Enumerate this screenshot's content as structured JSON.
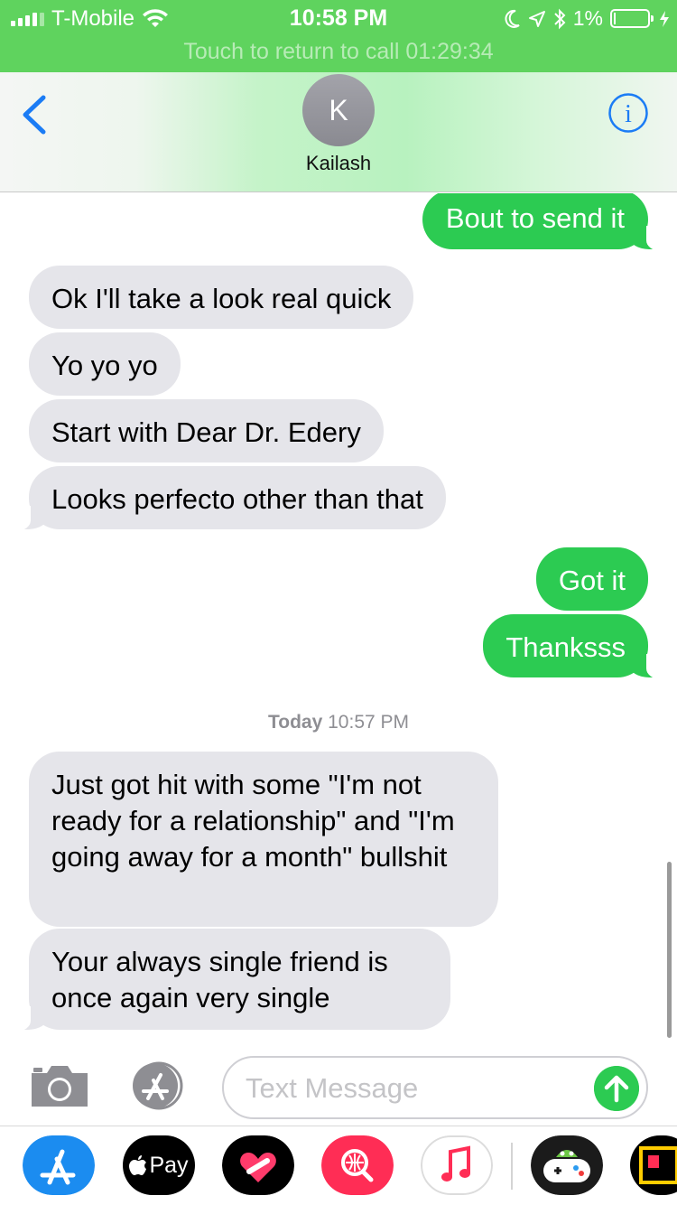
{
  "status_bar": {
    "carrier": "T-Mobile",
    "time": "10:58 PM",
    "battery": "1%",
    "call_banner": "Touch to return to call 01:29:34"
  },
  "header": {
    "avatar_initial": "K",
    "contact_name": "Kailash"
  },
  "messages": [
    {
      "direction": "sent",
      "text": "Bout to send it"
    },
    {
      "direction": "received",
      "text": "Ok I'll take a look real quick"
    },
    {
      "direction": "received",
      "text": "Yo yo yo"
    },
    {
      "direction": "received",
      "text": "Start with Dear Dr. Edery"
    },
    {
      "direction": "received",
      "text": "Looks perfecto other than that"
    },
    {
      "direction": "sent",
      "text": "Got it"
    },
    {
      "direction": "sent",
      "text": "Thanksss"
    },
    {
      "direction": "received",
      "text": "Just got hit with some \"I'm not ready for a relationship\" and \"I'm going away for a month\" bullshit"
    },
    {
      "direction": "received",
      "text": "Your always single friend is once again very single"
    }
  ],
  "timestamp": {
    "day": "Today",
    "time": "10:57 PM"
  },
  "input": {
    "placeholder": "Text Message"
  },
  "app_drawer": {
    "items": [
      "app-store-icon",
      "apple-pay-icon",
      "digital-touch-icon",
      "image-search-icon",
      "music-icon",
      "game-controller-icon",
      "partial-app-icon"
    ],
    "apple_pay_label": "Pay"
  },
  "colors": {
    "call_banner": "#5fd35e",
    "sent_bubble": "#2ccb52",
    "received_bubble": "#e5e5ea",
    "ios_blue": "#1b7cf5"
  }
}
